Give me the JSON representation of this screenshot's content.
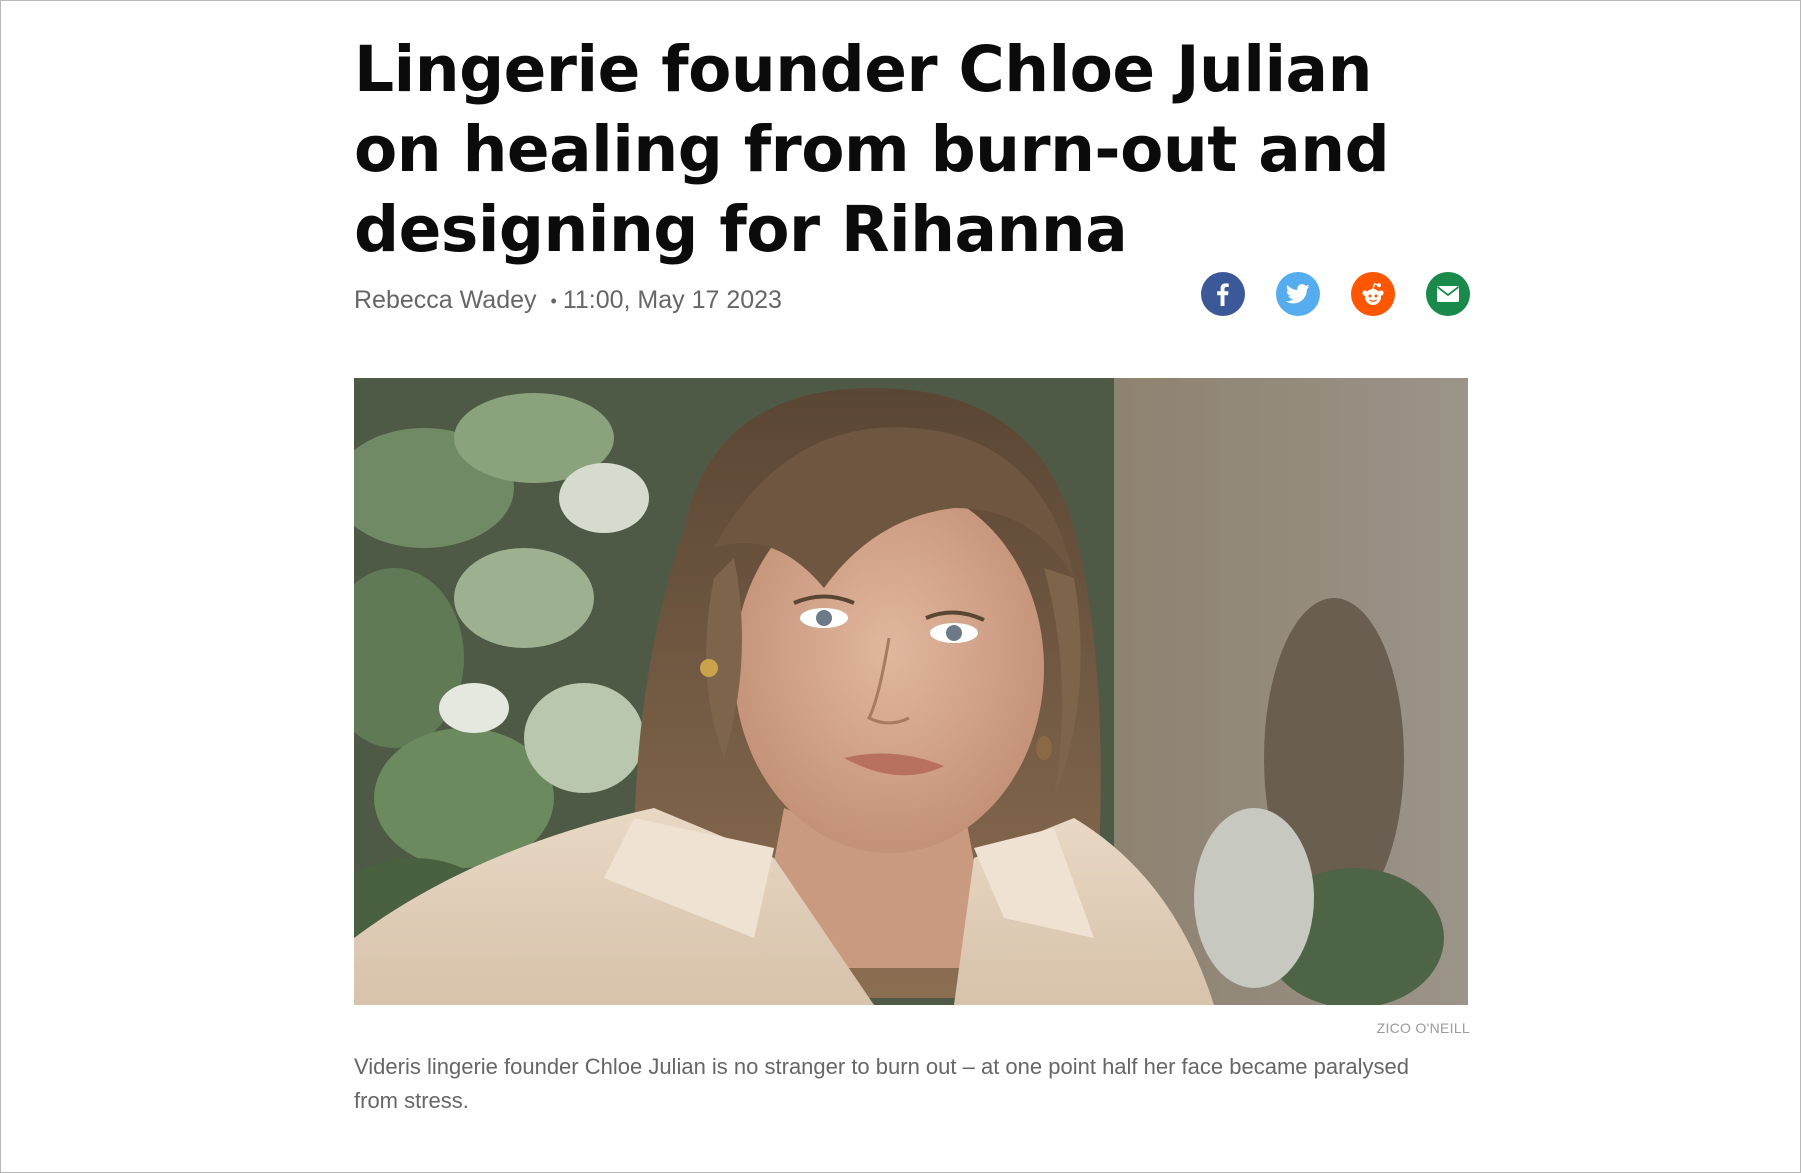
{
  "article": {
    "headline": "Lingerie founder Chloe Julian on healing from burn-out and designing for Rihanna",
    "author": "Rebecca Wadey",
    "separator": "•",
    "timestamp": "11:00, May 17 2023"
  },
  "share": {
    "items": [
      {
        "icon": "facebook-icon",
        "color": "#3b5998"
      },
      {
        "icon": "twitter-icon",
        "color": "#55acee"
      },
      {
        "icon": "reddit-icon",
        "color": "#ff5700"
      },
      {
        "icon": "email-icon",
        "color": "#1a8a4a"
      }
    ]
  },
  "image": {
    "credit": "ZICO O'NEILL",
    "caption": "Videris lingerie founder Chloe Julian is no stranger to burn out – at one point half her face became paralysed from stress."
  }
}
